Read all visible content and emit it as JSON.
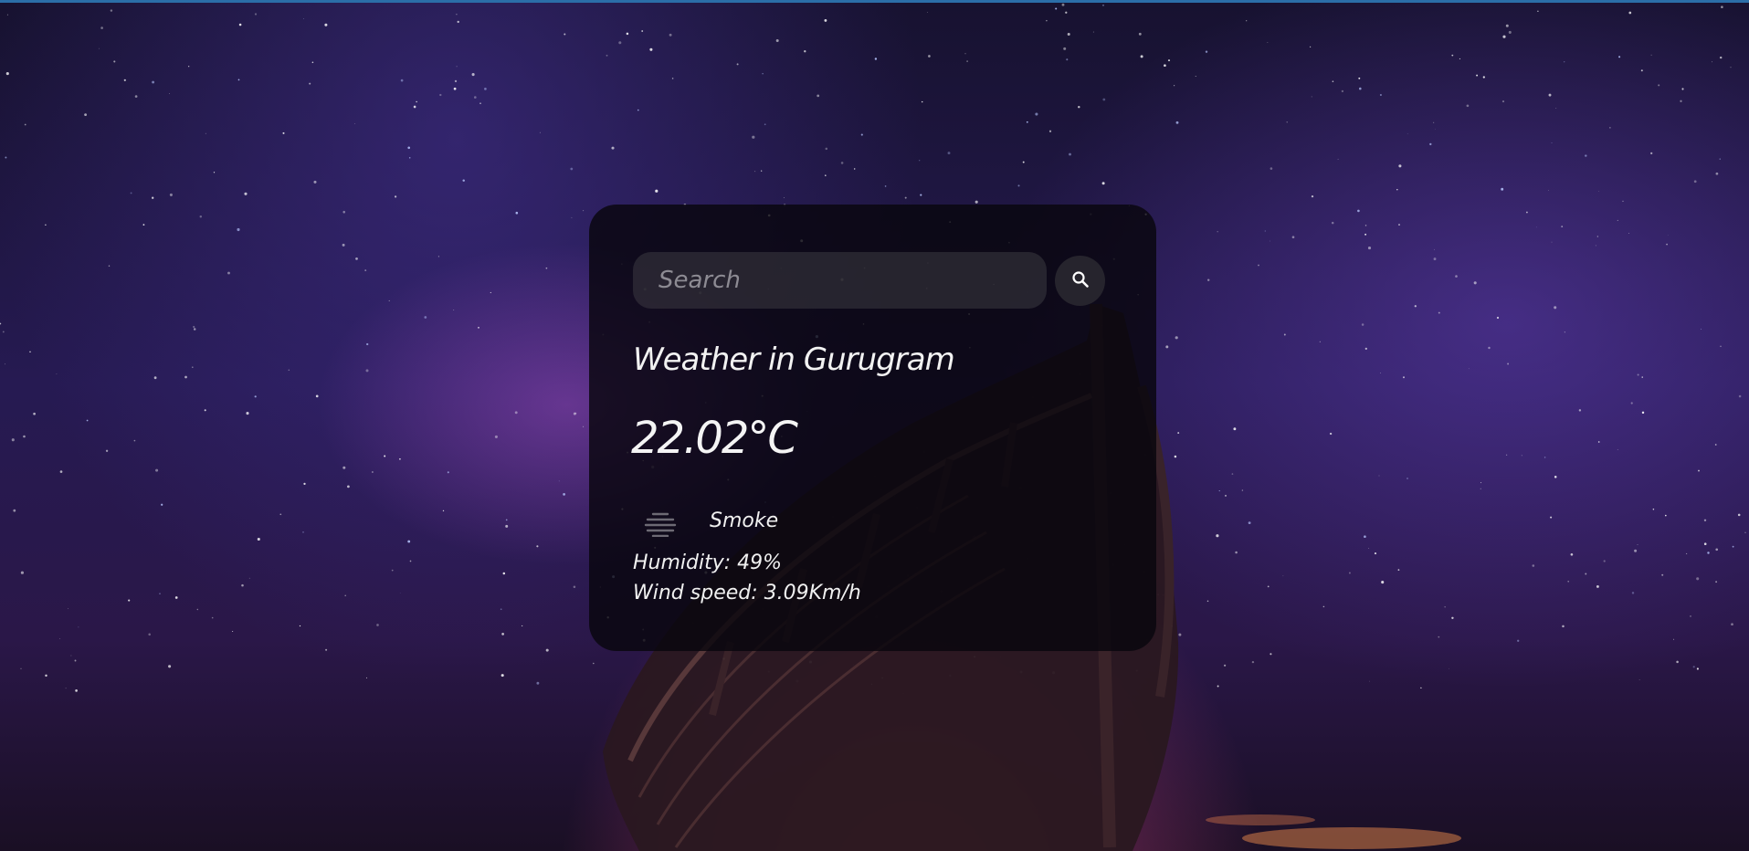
{
  "search": {
    "placeholder": "Search",
    "value": ""
  },
  "weather": {
    "title": "Weather in Gurugram",
    "temperature": "22.02°C",
    "condition": "Smoke",
    "humidity": "Humidity: 49%",
    "wind": "Wind speed: 3.09Km/h"
  },
  "icons": {
    "search_button": "search-icon",
    "condition": "smoke-haze-icon"
  },
  "colors": {
    "card_background": "#08060e",
    "text": "#f0f0f0",
    "top_strip": "#2b6ea8"
  }
}
